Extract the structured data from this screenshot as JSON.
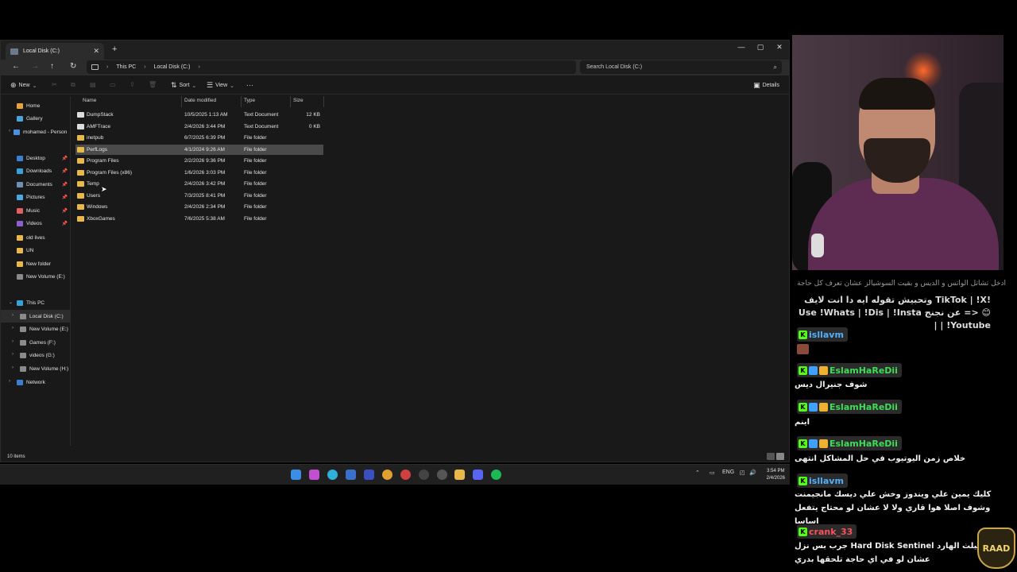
{
  "window": {
    "tab_title": "Local Disk (C:)",
    "new_tab": "+",
    "controls": [
      "—",
      "▢",
      "✕"
    ]
  },
  "address": {
    "breadcrumb": [
      "This PC",
      "Local Disk (C:)"
    ],
    "search_placeholder": "Search Local Disk (C:)"
  },
  "toolbar": {
    "new_label": "New",
    "sort_label": "Sort",
    "view_label": "View",
    "more_label": "···",
    "details_label": "Details"
  },
  "sidebar": {
    "quick": [
      {
        "label": "Home",
        "color": "#e7a33a"
      },
      {
        "label": "Gallery",
        "color": "#4aa3df"
      },
      {
        "label": "mohamed - Person",
        "color": "#4a8fe0"
      },
      {
        "label": "Desktop",
        "color": "#3c7fd0",
        "pinned": true
      },
      {
        "label": "Downloads",
        "color": "#3aa0d8",
        "pinned": true
      },
      {
        "label": "Documents",
        "color": "#6d8fb8",
        "pinned": true
      },
      {
        "label": "Pictures",
        "color": "#4aa8e0",
        "pinned": true
      },
      {
        "label": "Music",
        "color": "#e06060",
        "pinned": true
      },
      {
        "label": "Videos",
        "color": "#8a60d0",
        "pinned": true
      },
      {
        "label": "old lives",
        "color": "#e8b84a"
      },
      {
        "label": "UN",
        "color": "#e8b84a"
      },
      {
        "label": "New folder",
        "color": "#e8b84a"
      },
      {
        "label": "New Volume (E:)",
        "color": "#8a8a8a"
      }
    ],
    "this_pc": "This PC",
    "drives": [
      "Local Disk (C:)",
      "New Volume (E:)",
      "Games (F:)",
      "videos (G:)",
      "New Volume (H:)"
    ],
    "network": "Network"
  },
  "columns": {
    "name": "Name",
    "date": "Date modified",
    "type": "Type",
    "size": "Size"
  },
  "files": [
    {
      "name": "DumpStack",
      "date": "10/5/2025 1:13 AM",
      "type": "Text Document",
      "size": "12 KB",
      "kind": "doc"
    },
    {
      "name": "AMFTrace",
      "date": "2/4/2026 3:44 PM",
      "type": "Text Document",
      "size": "0 KB",
      "kind": "doc"
    },
    {
      "name": "inetpub",
      "date": "6/7/2025 6:39 PM",
      "type": "File folder",
      "size": "",
      "kind": "folder"
    },
    {
      "name": "PerfLogs",
      "date": "4/1/2024 9:26 AM",
      "type": "File folder",
      "size": "",
      "kind": "folder"
    },
    {
      "name": "Program Files",
      "date": "2/2/2026 9:36 PM",
      "type": "File folder",
      "size": "",
      "kind": "folder"
    },
    {
      "name": "Program Files (x86)",
      "date": "1/6/2026 3:03 PM",
      "type": "File folder",
      "size": "",
      "kind": "folder"
    },
    {
      "name": "Temp",
      "date": "2/4/2026 3:42 PM",
      "type": "File folder",
      "size": "",
      "kind": "folder"
    },
    {
      "name": "Users",
      "date": "7/3/2025 8:41 PM",
      "type": "File folder",
      "size": "",
      "kind": "folder"
    },
    {
      "name": "Windows",
      "date": "2/4/2026 2:34 PM",
      "type": "File folder",
      "size": "",
      "kind": "folder"
    },
    {
      "name": "XboxGames",
      "date": "7/6/2025 5:38 AM",
      "type": "File folder",
      "size": "",
      "kind": "folder"
    }
  ],
  "status": {
    "count": "10 items"
  },
  "taskbar": {
    "lang": "ENG",
    "time": "3:54 PM",
    "date": "2/4/2026"
  },
  "chat": {
    "header": "ادخل تشاتل الواتس و الديس و بقيت السوشيالز عشان تعرف كل حاجة",
    "pinned": "!TikTok | !X وتحبيش تقوله ايه دا انت لايف 😊 <= عن نجنج Use !Whats | !Dis | !Insta | !Youtube |",
    "messages": [
      {
        "user": "isllavm",
        "user_color": "#4fb0ff",
        "text": ""
      },
      {
        "user": "EslamHaReDii",
        "user_color": "#3fdc57",
        "text": "شوف جنيرال ديس"
      },
      {
        "user": "EslamHaReDii",
        "user_color": "#3fdc57",
        "text": "اينم"
      },
      {
        "user": "EslamHaReDii",
        "user_color": "#3fdc57",
        "text": "خلاص زمن اليوتيوب في حل المشاكل انتهى"
      },
      {
        "user": "isllavm",
        "user_color": "#4fb0ff",
        "text": "كليك يمين علي ويندوز وخش علي ديسك مانجيمنت وشوف اصلا هوا قاري ولا لا عشان لو محتاج يتفعل اساسا"
      },
      {
        "user": "crank_33",
        "user_color": "#ff4f5a",
        "text": "شوف هيلث الهارد Hard Disk Sentinel جرب بس نزل عشان لو في اي حاجة تلحقها بدري"
      }
    ],
    "logo": "RAAD"
  }
}
